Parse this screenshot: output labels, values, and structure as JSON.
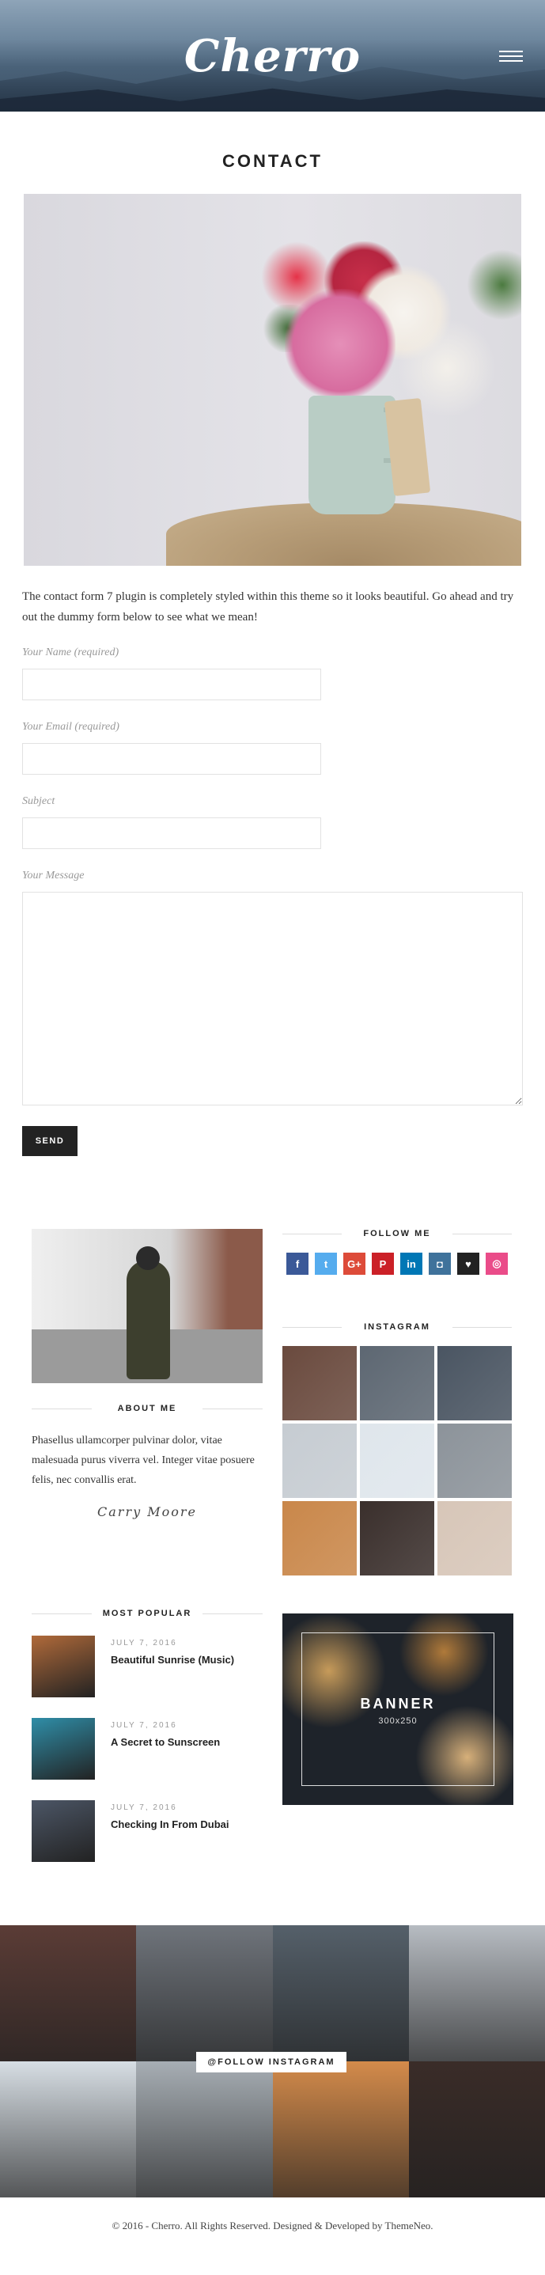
{
  "header": {
    "logo": "Cherro",
    "menu_icon": "hamburger-icon"
  },
  "page": {
    "title": "CONTACT",
    "intro": "The contact form 7 plugin is completely styled within this theme so it looks beautiful. Go ahead and try out the dummy form below to see what we mean!"
  },
  "form": {
    "name_label": "Your Name (required)",
    "email_label": "Your Email (required)",
    "subject_label": "Subject",
    "message_label": "Your Message",
    "name_value": "",
    "email_value": "",
    "subject_value": "",
    "message_value": "",
    "send_label": "SEND"
  },
  "about": {
    "title": "ABOUT ME",
    "text": "Phasellus ullamcorper pulvinar dolor, vitae malesuada purus viverra vel. Integer vitae posuere felis, nec convallis erat.",
    "signature": "Carry Moore"
  },
  "follow": {
    "title": "FOLLOW ME",
    "icons": [
      {
        "name": "facebook-icon",
        "glyph": "f",
        "color": "#3b5998"
      },
      {
        "name": "twitter-icon",
        "glyph": "t",
        "color": "#55acee"
      },
      {
        "name": "google-plus-icon",
        "glyph": "G+",
        "color": "#dd4b39"
      },
      {
        "name": "pinterest-icon",
        "glyph": "P",
        "color": "#cb2027"
      },
      {
        "name": "linkedin-icon",
        "glyph": "in",
        "color": "#0077b5"
      },
      {
        "name": "instagram-icon",
        "glyph": "◘",
        "color": "#3f729b"
      },
      {
        "name": "bloglovin-icon",
        "glyph": "♥",
        "color": "#222222"
      },
      {
        "name": "dribbble-icon",
        "glyph": "◎",
        "color": "#ea4c89"
      }
    ]
  },
  "instagram": {
    "title": "INSTAGRAM",
    "tiles": [
      "#6a4a3e",
      "#5d6772",
      "#4a5562",
      "#c6ccd2",
      "#dfe6ec",
      "#8c939a",
      "#c9874a",
      "#3a2f2c",
      "#d7c6b8"
    ]
  },
  "popular": {
    "title": "MOST POPULAR",
    "items": [
      {
        "date": "JULY 7, 2016",
        "title": "Beautiful Sunrise (Music)",
        "color": "#b06a3a"
      },
      {
        "date": "JULY 7, 2016",
        "title": "A Secret to Sunscreen",
        "color": "#2f8ea8"
      },
      {
        "date": "JULY 7, 2016",
        "title": "Checking In From Dubai",
        "color": "#4c5666"
      }
    ]
  },
  "banner": {
    "title": "BANNER",
    "size": "300x250"
  },
  "instagram_strip": {
    "label": "@FOLLOW INSTAGRAM",
    "tiles": [
      "#5b3c36",
      "#6f747b",
      "#55606a",
      "#b7bcc2",
      "#d7dee4",
      "#a7aeb4",
      "#d48b4b",
      "#3a2c28"
    ]
  },
  "footer": {
    "text": "© 2016 - Cherro. All Rights Reserved. Designed & Developed by ThemeNeo."
  }
}
